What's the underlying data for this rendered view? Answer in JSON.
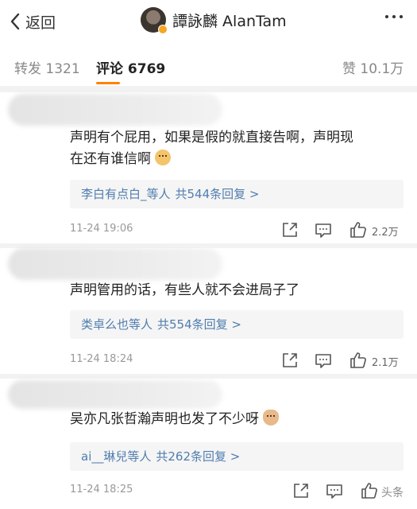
{
  "header": {
    "back_label": "返回",
    "title": "譚詠麟 AlanTam"
  },
  "tabs": [
    {
      "label": "转发",
      "count": "1321"
    },
    {
      "label": "评论",
      "count": "6769"
    },
    {
      "label": "赞",
      "count": "10.1万"
    }
  ],
  "comments": [
    {
      "text_line1": "声明有个屁用，如果是假的就直接告啊，声明现",
      "text_line2": "在还有谁信啊",
      "emoji": "doge-emoji",
      "reply_users": "李白有点白_等人",
      "reply_count": "共544条回复 >",
      "time": "11-24 19:06",
      "likes": "2.2万"
    },
    {
      "text_line1": "声明管用的话，有些人就不会进局子了",
      "reply_users": "类卓么也等人",
      "reply_count": "共554条回复 >",
      "time": "11-24 18:24",
      "likes": "2.1万"
    },
    {
      "text_line1": "吴亦凡张哲瀚声明也发了不少呀",
      "emoji": "cat-emoji",
      "reply_users": "ai__琳兒等人",
      "reply_count": "共262条回复 >",
      "time": "11-24 18:25",
      "likes": ""
    }
  ],
  "watermark": "头条"
}
